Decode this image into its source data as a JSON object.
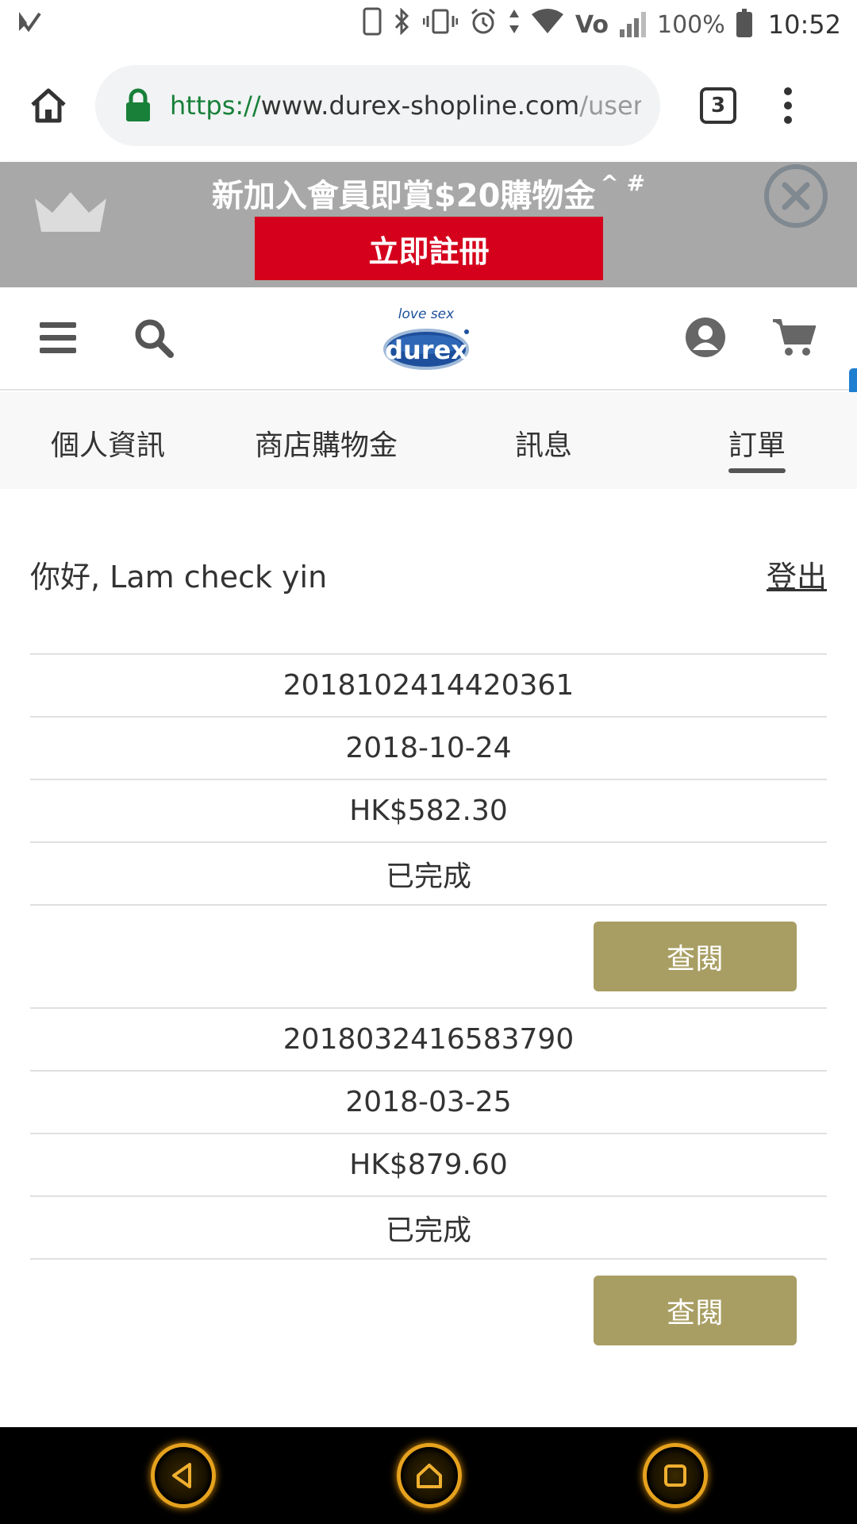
{
  "status_bar": {
    "battery": "100%",
    "time": "10:52",
    "icons": [
      "check-icon",
      "phone-icon",
      "bluetooth-icon",
      "vibrate-icon",
      "alarm-icon",
      "data-arrows-icon",
      "wifi-icon",
      "volte-icon",
      "signal-icon",
      "battery-icon"
    ]
  },
  "browser": {
    "url_scheme": "https://",
    "url_host": "www.durex-shopline.com",
    "url_path": "/users",
    "tab_count": "3",
    "icons": [
      "home-icon",
      "lock-icon",
      "tabs-icon",
      "more-vert-icon"
    ]
  },
  "promo": {
    "title": "新加入會員即賞$20購物金",
    "title_suffix": "^ #",
    "cta": "立即註冊",
    "icons": [
      "crown-icon",
      "close-circle-icon"
    ]
  },
  "header": {
    "logo_tagline": "love sex",
    "logo_text": "durex",
    "icons": [
      "menu-icon",
      "search-icon",
      "user-icon",
      "cart-icon"
    ]
  },
  "account_tabs": [
    {
      "label": "個人資訊",
      "active": false
    },
    {
      "label": "商店購物金",
      "active": false
    },
    {
      "label": "訊息",
      "active": false
    },
    {
      "label": "訂單",
      "active": true
    }
  ],
  "greeting": "你好, Lam check yin",
  "logout_label": "登出",
  "orders": [
    {
      "order_no": "2018102414420361",
      "date": "2018-10-24",
      "total": "HK$582.30",
      "status": "已完成",
      "action": "查閱"
    },
    {
      "order_no": "2018032416583790",
      "date": "2018-03-25",
      "total": "HK$879.60",
      "status": "已完成",
      "action": "查閱"
    }
  ],
  "nav_bar": {
    "icons": [
      "back-icon",
      "home-nav-icon",
      "recents-icon"
    ]
  },
  "colors": {
    "accent_button": "#a89e63",
    "promo_red": "#d5001c",
    "promo_bg": "#a8a8a8",
    "secure_green": "#188038"
  }
}
